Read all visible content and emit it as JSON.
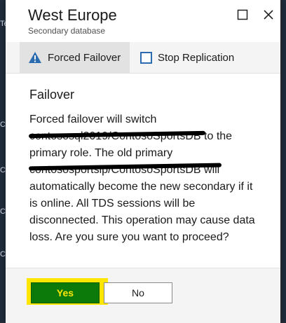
{
  "background": {
    "left_letters": [
      "Te",
      "C",
      "C",
      "C",
      "C"
    ]
  },
  "header": {
    "title": "West Europe",
    "subtitle": "Secondary database",
    "maximize_icon": "maximize-icon",
    "close_icon": "close-icon"
  },
  "toolbar": {
    "forced_failover_label": "Forced Failover",
    "forced_failover_icon": "warning-icon",
    "stop_replication_label": "Stop Replication",
    "stop_replication_icon": "checkbox-icon"
  },
  "content": {
    "section_title": "Failover",
    "message": "Forced failover will switch contososql2019/ContosoSportsDB to the primary role. The old primary contososportsip/ContosoSportsDB will automatically become the new secondary if it is online. All TDS sessions will be disconnected. This operation may cause data loss. Are you sure you want to proceed?"
  },
  "footer": {
    "yes_label": "Yes",
    "no_label": "No",
    "peek_text": "...,"
  },
  "colors": {
    "accent": "#2b6cb0",
    "yes_bg": "#0b7a0b",
    "yes_text": "#ffe600",
    "highlight": "#ffe600"
  }
}
